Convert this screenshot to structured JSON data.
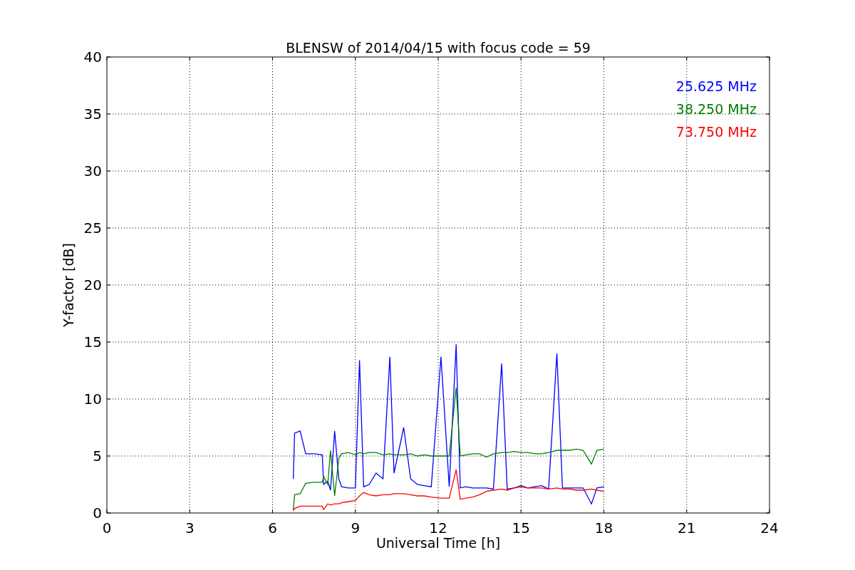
{
  "chart_data": {
    "type": "line",
    "title": "BLENSW of 2014/04/15 with focus code = 59",
    "xlabel": "Universal Time [h]",
    "ylabel": "Y-factor [dB]",
    "xlim": [
      0,
      24
    ],
    "ylim": [
      0,
      40
    ],
    "xticks": [
      0,
      3,
      6,
      9,
      12,
      15,
      18,
      21,
      24
    ],
    "yticks": [
      0,
      5,
      10,
      15,
      20,
      25,
      30,
      35,
      40
    ],
    "grid": true,
    "x": [
      6.75,
      6.8,
      7.0,
      7.2,
      7.5,
      7.8,
      7.85,
      8.0,
      8.1,
      8.25,
      8.4,
      8.5,
      8.75,
      9.0,
      9.15,
      9.3,
      9.5,
      9.75,
      10.0,
      10.25,
      10.4,
      10.75,
      11.0,
      11.25,
      11.5,
      11.75,
      12.1,
      12.4,
      12.65,
      12.8,
      13.0,
      13.25,
      13.5,
      13.75,
      14.0,
      14.3,
      14.5,
      14.75,
      15.0,
      15.25,
      15.5,
      15.75,
      16.0,
      16.3,
      16.5,
      16.75,
      17.0,
      17.25,
      17.55,
      17.75,
      18.0
    ],
    "series": [
      {
        "name": "25.625 MHz",
        "color": "#0000ff",
        "values": [
          3.0,
          7.0,
          7.2,
          5.2,
          5.2,
          5.1,
          2.5,
          2.8,
          2.0,
          7.2,
          3.0,
          2.3,
          2.2,
          2.2,
          13.4,
          2.3,
          2.5,
          3.5,
          3.0,
          13.7,
          3.5,
          7.5,
          3.0,
          2.5,
          2.4,
          2.3,
          13.7,
          2.3,
          14.8,
          2.2,
          2.3,
          2.2,
          2.2,
          2.2,
          2.1,
          13.1,
          2.1,
          2.2,
          2.4,
          2.2,
          2.3,
          2.4,
          2.1,
          14.0,
          2.2,
          2.2,
          2.2,
          2.2,
          0.8,
          2.2,
          2.3
        ]
      },
      {
        "name": "38.250 MHz",
        "color": "#008000",
        "values": [
          0.3,
          1.6,
          1.7,
          2.6,
          2.7,
          2.7,
          3.2,
          2.5,
          5.5,
          1.5,
          4.8,
          5.2,
          5.3,
          5.1,
          5.3,
          5.2,
          5.3,
          5.3,
          5.1,
          5.2,
          5.1,
          5.1,
          5.2,
          5.0,
          5.1,
          5.0,
          5.0,
          5.0,
          11.0,
          5.0,
          5.1,
          5.2,
          5.2,
          4.9,
          5.2,
          5.3,
          5.3,
          5.4,
          5.3,
          5.3,
          5.2,
          5.2,
          5.3,
          5.5,
          5.5,
          5.5,
          5.6,
          5.5,
          4.3,
          5.5,
          5.6
        ]
      },
      {
        "name": "73.750 MHz",
        "color": "#ff0000",
        "values": [
          0.2,
          0.4,
          0.6,
          0.6,
          0.6,
          0.6,
          0.3,
          0.8,
          0.7,
          0.8,
          0.8,
          0.9,
          1.0,
          1.1,
          1.5,
          1.8,
          1.6,
          1.5,
          1.6,
          1.6,
          1.7,
          1.7,
          1.6,
          1.5,
          1.5,
          1.4,
          1.3,
          1.3,
          3.8,
          1.2,
          1.3,
          1.4,
          1.6,
          1.9,
          2.0,
          2.1,
          2.0,
          2.2,
          2.3,
          2.2,
          2.2,
          2.2,
          2.1,
          2.2,
          2.1,
          2.1,
          2.0,
          2.0,
          2.1,
          2.0,
          1.9
        ]
      }
    ]
  }
}
